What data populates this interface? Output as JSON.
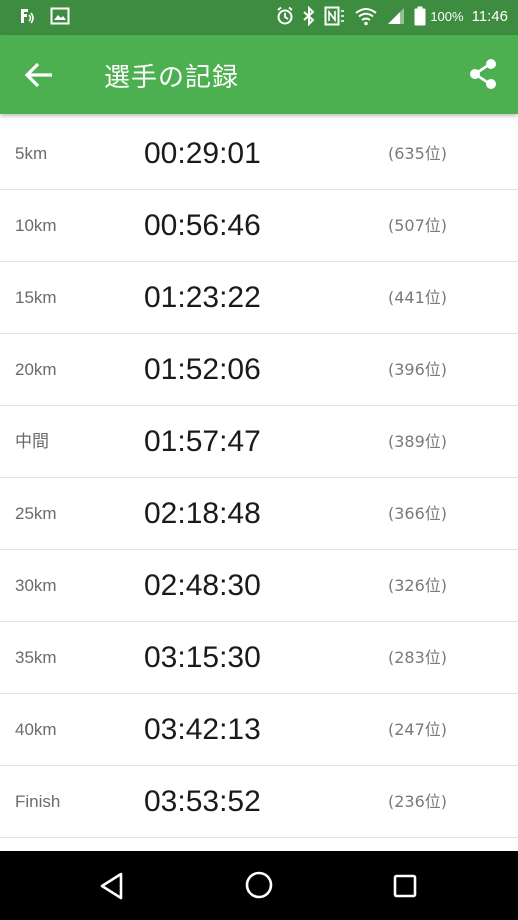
{
  "status_bar": {
    "time": "11:46",
    "battery_percent": "100%",
    "icons": [
      "flash-auto-icon",
      "image-icon",
      "alarm-icon",
      "bluetooth-icon",
      "nfc-icon",
      "wifi-icon",
      "signal-icon",
      "battery-icon"
    ]
  },
  "app_bar": {
    "title": "選手の記録",
    "back_icon": "arrow-back-icon",
    "share_icon": "share-icon",
    "color": "#4caf50"
  },
  "records": [
    {
      "label": "5km",
      "time": "00:29:01",
      "rank": "(635位)"
    },
    {
      "label": "10km",
      "time": "00:56:46",
      "rank": "(507位)"
    },
    {
      "label": "15km",
      "time": "01:23:22",
      "rank": "(441位)"
    },
    {
      "label": "20km",
      "time": "01:52:06",
      "rank": "(396位)"
    },
    {
      "label": "中間",
      "time": "01:57:47",
      "rank": "(389位)"
    },
    {
      "label": "25km",
      "time": "02:18:48",
      "rank": "(366位)"
    },
    {
      "label": "30km",
      "time": "02:48:30",
      "rank": "(326位)"
    },
    {
      "label": "35km",
      "time": "03:15:30",
      "rank": "(283位)"
    },
    {
      "label": "40km",
      "time": "03:42:13",
      "rank": "(247位)"
    },
    {
      "label": "Finish",
      "time": "03:53:52",
      "rank": "(236位)"
    }
  ],
  "nav_bar": {
    "icons": [
      "nav-back-icon",
      "nav-home-icon",
      "nav-recent-apps-icon"
    ]
  }
}
